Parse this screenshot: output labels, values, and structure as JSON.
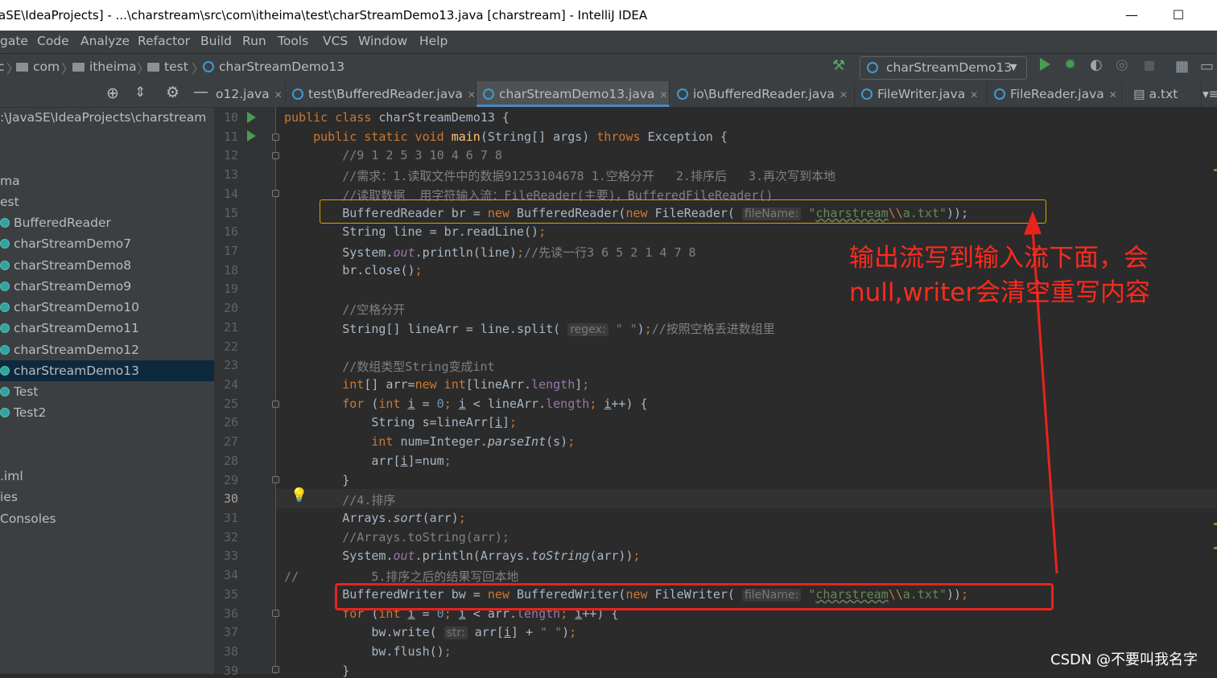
{
  "window": {
    "title": "aSE\\IdeaProjects] - ...\\charstream\\src\\com\\itheima\\test\\charStreamDemo13.java [charstream] - IntelliJ IDEA",
    "minimize": "—",
    "maximize": "☐"
  },
  "menu": {
    "items": [
      "gate",
      "Code",
      "Analyze",
      "Refactor",
      "Build",
      "Run",
      "Tools",
      "VCS",
      "Window",
      "Help"
    ]
  },
  "breadcrumb": {
    "lead": "c",
    "items": [
      "com",
      "itheima",
      "test",
      "charStreamDemo13"
    ]
  },
  "run_config": {
    "label": "charStreamDemo13"
  },
  "project": {
    "root_path": ":\\JavaSE\\IdeaProjects\\charstream",
    "items": [
      "ma",
      "est",
      "BufferedReader",
      "charStreamDemo7",
      "charStreamDemo8",
      "charStreamDemo9",
      "charStreamDemo10",
      "charStreamDemo11",
      "charStreamDemo12",
      "charStreamDemo13",
      "Test",
      "Test2",
      ".iml",
      "ies",
      "Consoles"
    ]
  },
  "tabs": [
    "o12.java",
    "test\\BufferedReader.java",
    "charStreamDemo13.java",
    "io\\BufferedReader.java",
    "FileWriter.java",
    "FileReader.java",
    "a.txt"
  ],
  "editor": {
    "line_numbers": [
      "10",
      "11",
      "12",
      "13",
      "14",
      "15",
      "16",
      "17",
      "18",
      "19",
      "20",
      "21",
      "22",
      "23",
      "24",
      "25",
      "26",
      "27",
      "28",
      "29",
      "30",
      "31",
      "32",
      "33",
      "34",
      "35",
      "36",
      "37",
      "38",
      "39"
    ],
    "hint_filename": "fileName:",
    "hint_regex": "regex:",
    "hint_str": "str:"
  },
  "annotation": {
    "line1": "输出流写到输入流下面，会",
    "line2": "null,writer会清空重写内容"
  },
  "watermark": "CSDN @不要叫我名字",
  "colors": {
    "annotation_red": "#e8231d",
    "highlight_yellow": "#d6a200",
    "keyword": "#cc7832",
    "string": "#6a8759"
  }
}
